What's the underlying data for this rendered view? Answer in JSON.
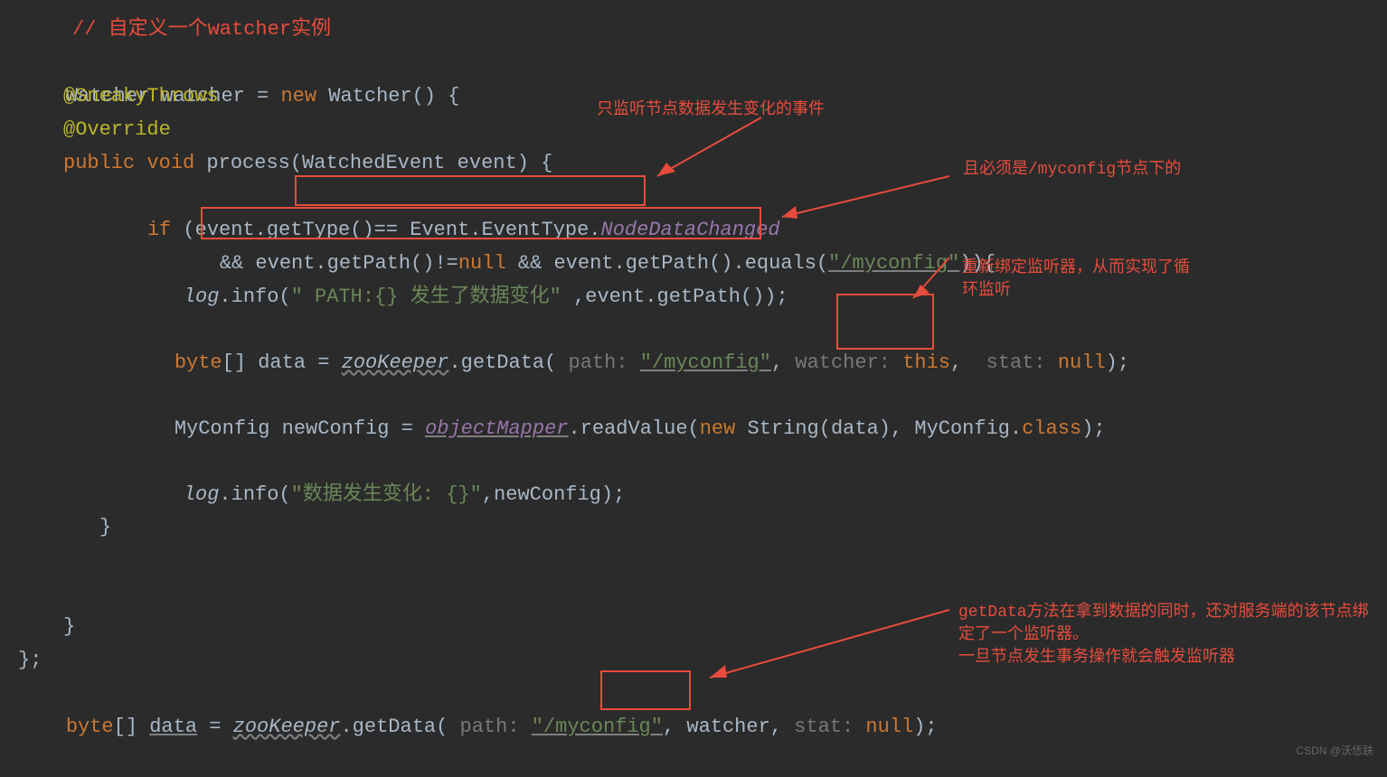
{
  "code": {
    "comment_top": "// 自定义一个watcher实例",
    "l1_a": "Watcher watcher = ",
    "l1_new": "new",
    "l1_b": " Watcher() {",
    "ann_sneaky": "@SneakyThrows",
    "ann_override": "@Override",
    "l4_kw": "public void",
    "l4_m": " process(WatchedEvent event) {",
    "l5_kw": "if",
    "l5_a": " (event.getType()==",
    "l5_b": "Event.EventType.",
    "l5_enum": "NodeDataChanged",
    "l6_a": "&& ",
    "l6_b": "event.getPath()!=",
    "l6_null": "null",
    "l6_c": " && event.getPath().equals(",
    "l6_str": "\"/myconfig\"",
    "l6_d": ")){",
    "l7_log": "log",
    "l7_m": ".info(",
    "l7_str": "\" PATH:{} 发生了数据变化\"",
    "l7_c": " ,event.getPath());",
    "l8_kw": "byte",
    "l8_a": "[] data = ",
    "l8_zoo": "zooKeeper",
    "l8_m": ".getData( ",
    "l8_h1": "path: ",
    "l8_str": "\"/myconfig\"",
    "l8_c": ", ",
    "l8_h2": "watcher: ",
    "l8_this": "this",
    "l8_c2": ", ",
    "l8_h3": "stat: ",
    "l8_null": "null",
    "l8_e": ");",
    "l9_a": "MyConfig newConfig = ",
    "l9_om": "objectMapper",
    "l9_m": ".readValue(",
    "l9_new": "new",
    "l9_b": " String(data), MyConfig.",
    "l9_class": "class",
    "l9_c": ");",
    "l10_log": "log",
    "l10_m": ".info(",
    "l10_str": "\"数据发生变化: {}\"",
    "l10_c": ",newConfig);",
    "brace_inner": "}",
    "brace_mid": "}",
    "brace_outer": "};",
    "l11_kw": "byte",
    "l11_a": "[] ",
    "l11_data": "data",
    "l11_b": " = ",
    "l11_zoo": "zooKeeper",
    "l11_m": ".getData( ",
    "l11_h1": "path: ",
    "l11_str": "\"/myconfig\"",
    "l11_c": ", watcher, ",
    "l11_h3": "stat: ",
    "l11_null": "null",
    "l11_e": ");"
  },
  "annotations": {
    "a1": "只监听节点数据发生变化的事件",
    "a2": "且必须是/myconfig节点下的",
    "a3": "重新绑定监听器，从而实现了循环监听",
    "a4": "getData方法在拿到数据的同时，还对服务端的该节点绑定了一个监听器。\n一旦节点发生事务操作就会触发监听器"
  },
  "watermark": "CSDN @沃恁趺"
}
